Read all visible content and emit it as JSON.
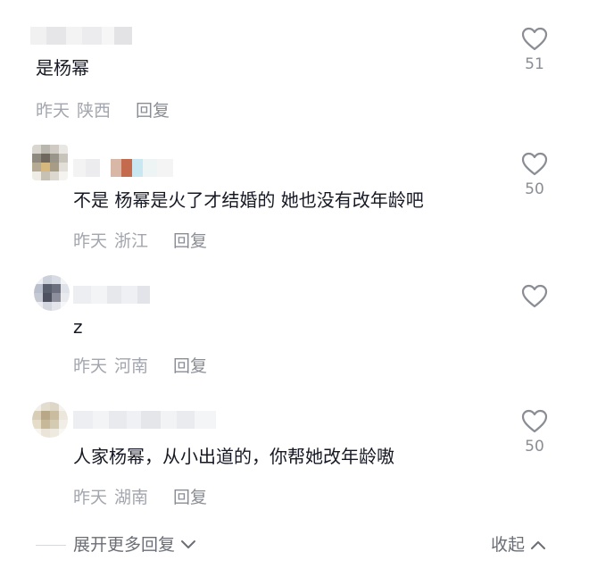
{
  "comments": [
    {
      "text": "是杨幂",
      "time": "昨天",
      "location": "陕西",
      "reply_label": "回复",
      "likes": "51",
      "icon": "heart-outline-icon"
    },
    {
      "text": "不是 杨幂是火了才结婚的 她也没有改年龄吧",
      "time": "昨天",
      "location": "浙江",
      "reply_label": "回复",
      "likes": "50",
      "icon": "heart-outline-icon"
    },
    {
      "text": "z",
      "time": "昨天",
      "location": "河南",
      "reply_label": "回复",
      "likes": "",
      "icon": "heart-outline-icon"
    },
    {
      "text": "人家杨幂，从小出道的，你帮她改年龄嗷",
      "time": "昨天",
      "location": "湖南",
      "reply_label": "回复",
      "likes": "50",
      "icon": "heart-outline-icon"
    }
  ],
  "footer": {
    "expand_label": "展开更多回复",
    "collapse_label": "收起"
  },
  "colors": {
    "text": "#161823",
    "meta": "#a3a6ad",
    "reply": "#8a8d94",
    "icon": "#8a8d94"
  }
}
